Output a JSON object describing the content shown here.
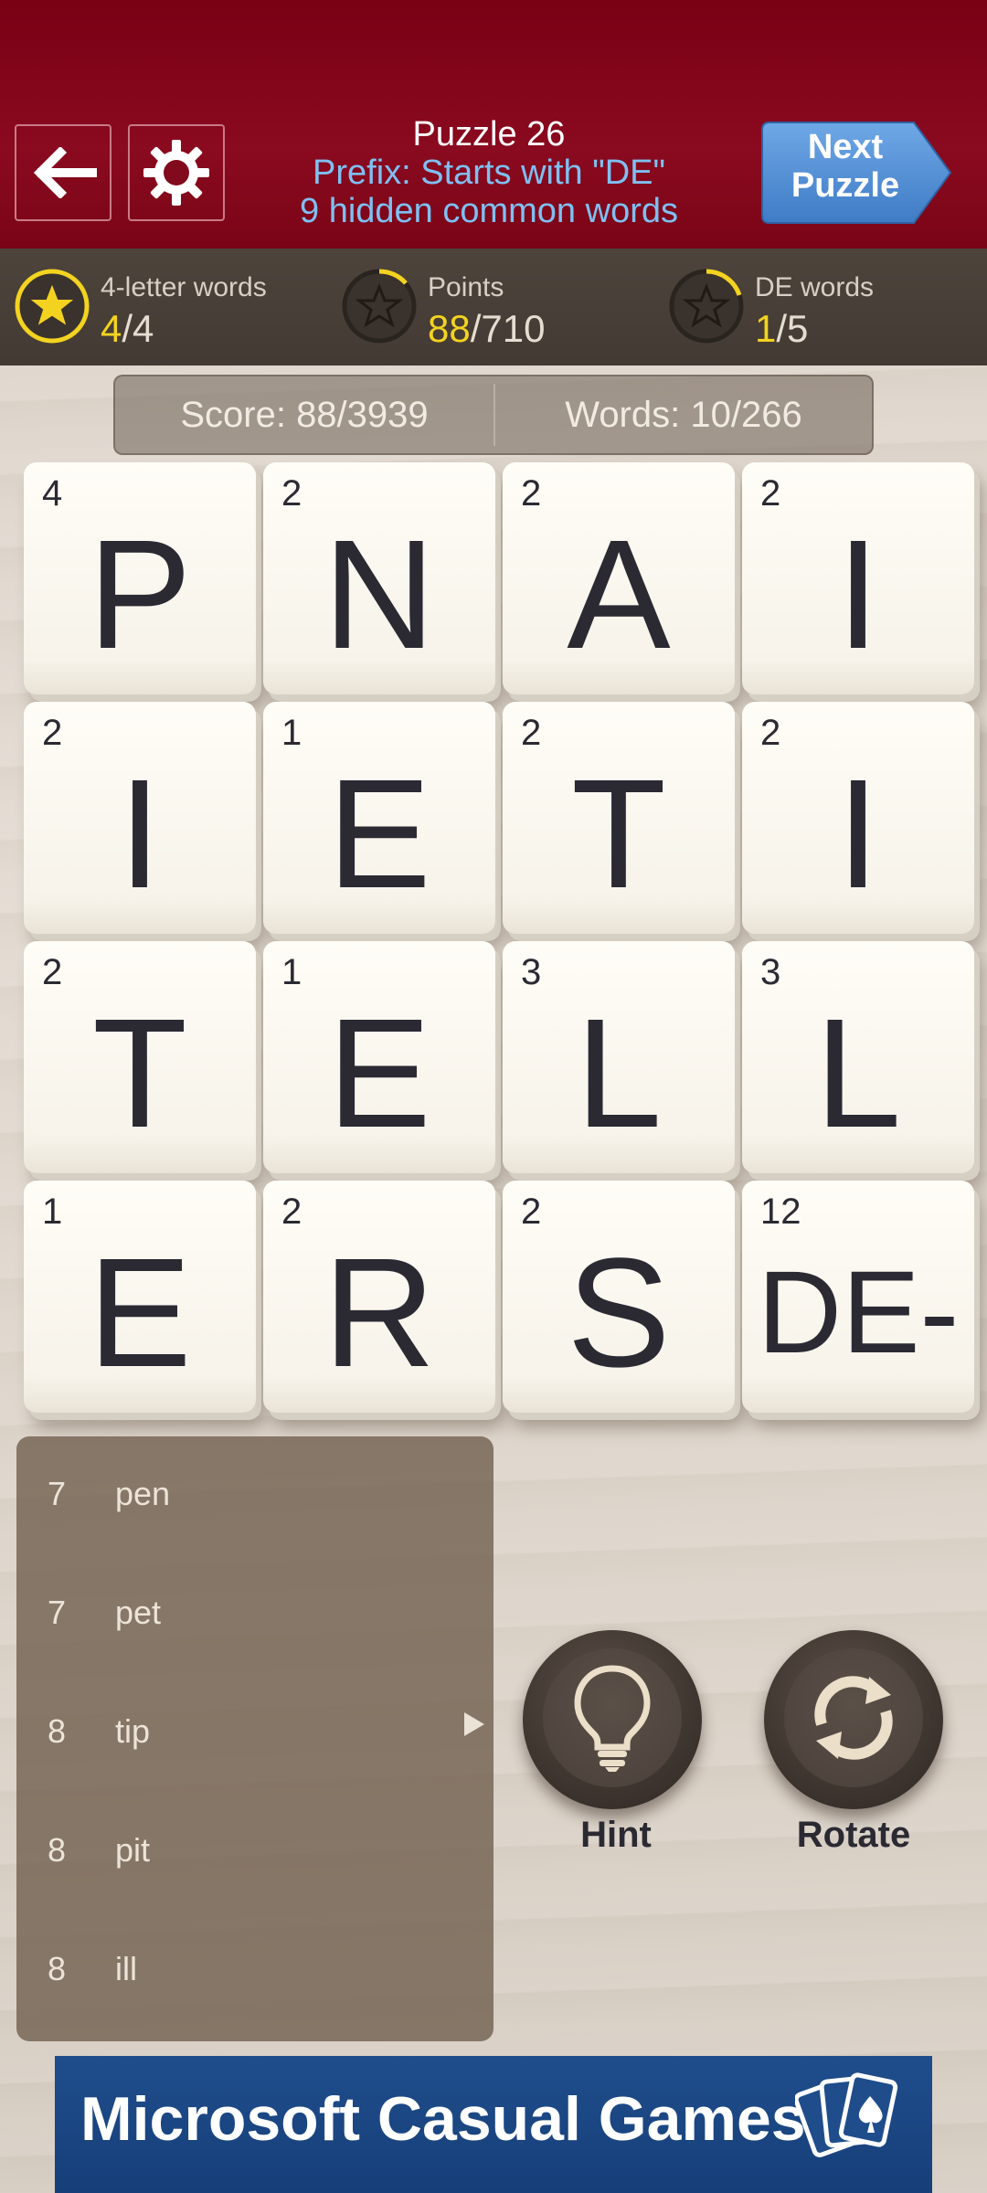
{
  "header": {
    "title": "Puzzle 26",
    "prefix_line": "Prefix: Starts with \"DE\"",
    "hidden_line": "9 hidden common words",
    "next_line1": "Next",
    "next_line2": "Puzzle",
    "back_icon": "back-arrow-icon",
    "settings_icon": "gear-icon"
  },
  "stats": [
    {
      "label": "4-letter words",
      "current": "4",
      "total": "/4",
      "progress": 1.0,
      "complete": true
    },
    {
      "label": "Points",
      "current": "88",
      "total": "/710",
      "progress": 0.12,
      "complete": false
    },
    {
      "label": "DE words",
      "current": "1",
      "total": "/5",
      "progress": 0.2,
      "complete": false
    }
  ],
  "scorebar": {
    "score": "Score: 88/3939",
    "words": "Words: 10/266"
  },
  "tiles": [
    {
      "letter": "P",
      "points": "4"
    },
    {
      "letter": "N",
      "points": "2"
    },
    {
      "letter": "A",
      "points": "2"
    },
    {
      "letter": "I",
      "points": "2"
    },
    {
      "letter": "I",
      "points": "2"
    },
    {
      "letter": "E",
      "points": "1"
    },
    {
      "letter": "T",
      "points": "2"
    },
    {
      "letter": "I",
      "points": "2"
    },
    {
      "letter": "T",
      "points": "2"
    },
    {
      "letter": "E",
      "points": "1"
    },
    {
      "letter": "L",
      "points": "3"
    },
    {
      "letter": "L",
      "points": "3"
    },
    {
      "letter": "E",
      "points": "1"
    },
    {
      "letter": "R",
      "points": "2"
    },
    {
      "letter": "S",
      "points": "2"
    },
    {
      "letter": "DE-",
      "points": "12"
    }
  ],
  "word_list": [
    {
      "score": "7",
      "word": "pen"
    },
    {
      "score": "7",
      "word": "pet"
    },
    {
      "score": "8",
      "word": "tip",
      "expand": true
    },
    {
      "score": "8",
      "word": "pit"
    },
    {
      "score": "8",
      "word": "ill"
    }
  ],
  "buttons": {
    "hint_label": "Hint",
    "rotate_label": "Rotate",
    "hint_icon": "lightbulb-icon",
    "rotate_icon": "rotate-icon"
  },
  "banner": {
    "text": "Microsoft Casual Games",
    "icon": "playing-cards-icon"
  },
  "colors": {
    "header": "#7a0014",
    "accent_yellow": "#f3d320",
    "link_blue": "#7ec0f3",
    "next_button": "#4a88cf",
    "banner": "#1f4d8c"
  }
}
